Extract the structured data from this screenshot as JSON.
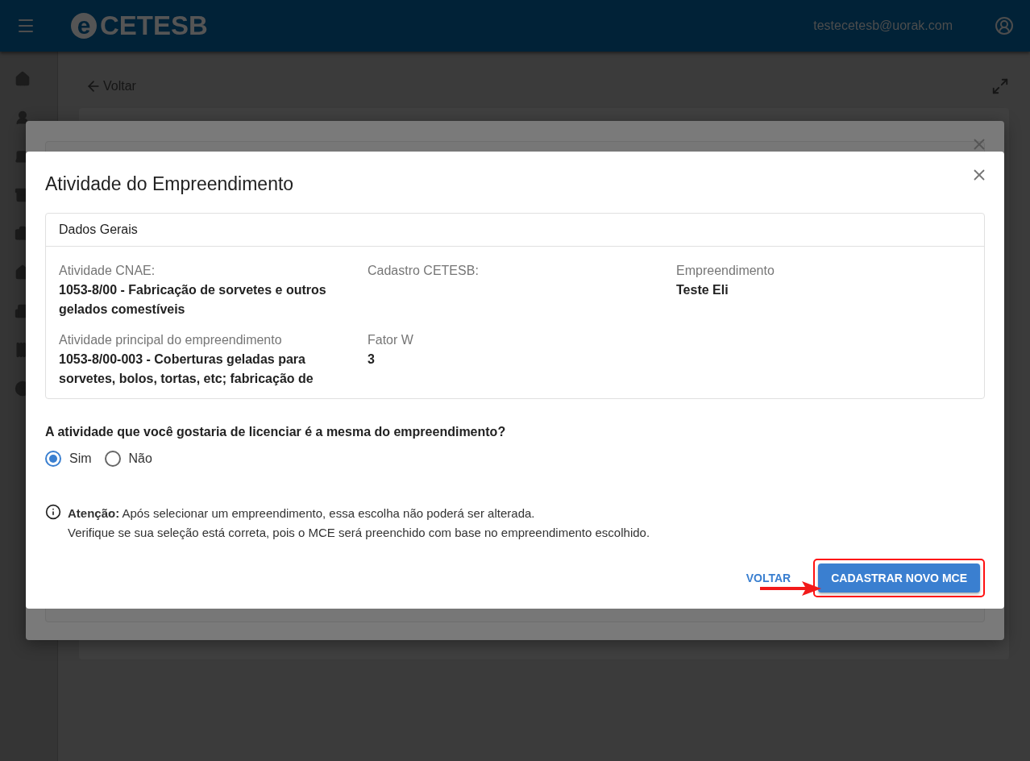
{
  "header": {
    "logo_mark": "e",
    "logo_text": "CETESB",
    "user_email": "testecetesb@uorak.com"
  },
  "page": {
    "back_link": "Voltar"
  },
  "modal": {
    "title": "Atividade do Empreendimento",
    "section_title": "Dados Gerais",
    "fields": [
      {
        "label": "Atividade CNAE:",
        "value": "1053-8/00 - Fabricação de sorvetes e outros gelados comestíveis"
      },
      {
        "label": "Cadastro CETESB:"
      },
      {
        "label": "Empreendimento",
        "value": "Teste Eli"
      },
      {
        "label": "Atividade principal do empreendimento",
        "value": "1053-8/00-003 - Coberturas geladas para sorvetes, bolos, tortas, etc; fabricação de"
      },
      {
        "label": "Fator W",
        "value": "3"
      }
    ],
    "question": "A atividade que você gostaria de licenciar é a mesma do empreendimento?",
    "options": [
      {
        "label": "Sim",
        "selected": true
      },
      {
        "label": "Não",
        "selected": false
      }
    ],
    "notice": [
      "**Atenção:**  Após selecionar um empreendimento, essa escolha não poderá ser alterada.",
      "Verifique se sua seleção está correta, pois o MCE será preenchido com base no empreendimento escolhido."
    ],
    "buttons": [
      {
        "label": "VOLTAR",
        "kind": "text",
        "highlighted": false
      },
      {
        "label": "CADASTRAR NOVO MCE",
        "kind": "contained",
        "highlighted": true
      }
    ]
  }
}
